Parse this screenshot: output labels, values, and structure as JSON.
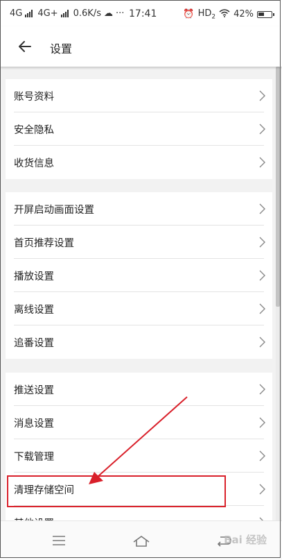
{
  "status_bar": {
    "net1": "4G",
    "net2": "4G+",
    "speed": "0.6K/s",
    "dots": "···",
    "time": "17:41",
    "hd": "HD",
    "hd_sub": "2",
    "battery": "42%"
  },
  "header": {
    "title": "设置"
  },
  "groups": [
    {
      "items": [
        "账号资料",
        "安全隐私",
        "收货信息"
      ]
    },
    {
      "items": [
        "开屏启动画面设置",
        "首页推荐设置",
        "播放设置",
        "离线设置",
        "追番设置"
      ]
    },
    {
      "items": [
        "推送设置",
        "消息设置",
        "下载管理",
        "清理存储空间",
        "其他设置"
      ]
    }
  ],
  "annotation": {
    "color": "#d9202a"
  },
  "watermark": "Bai 经验"
}
